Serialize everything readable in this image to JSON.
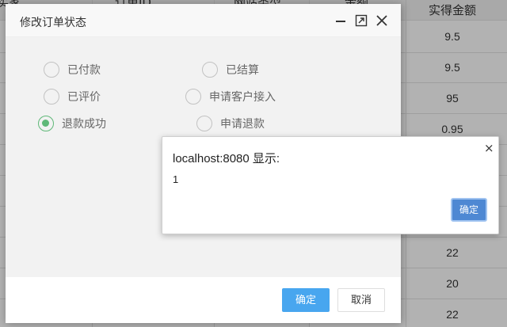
{
  "background_table": {
    "headers": [
      "买家",
      "订单ID",
      "网站类型",
      "金额",
      "实得金额"
    ],
    "rows": [
      "9.5",
      "9.5",
      "95",
      "0.95",
      "",
      "",
      "",
      "22",
      "20",
      "22"
    ]
  },
  "dialog": {
    "title": "修改订单状态",
    "options": [
      {
        "label": "已付款",
        "checked": false
      },
      {
        "label": "已结算",
        "checked": false
      },
      {
        "label": "已评价",
        "checked": false
      },
      {
        "label": "申请客户接入",
        "checked": false
      },
      {
        "label": "退款成功",
        "checked": true
      },
      {
        "label": "申请退款",
        "checked": false
      }
    ],
    "confirm_label": "确定",
    "cancel_label": "取消"
  },
  "alert": {
    "title": "localhost:8080 显示:",
    "message": "1",
    "close_glyph": "×",
    "ok_label": "确定"
  },
  "colors": {
    "accent_green": "#5FB878",
    "primary_blue": "#48a6ef",
    "alert_blue": "#4e88d3"
  }
}
